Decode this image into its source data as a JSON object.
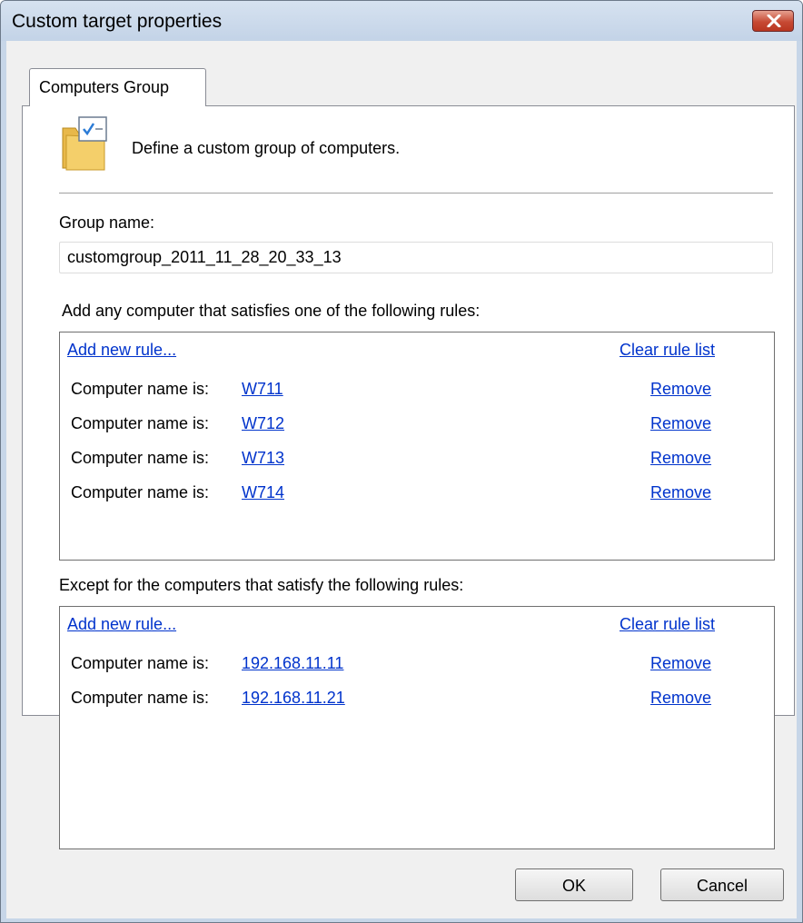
{
  "window": {
    "title": "Custom target properties"
  },
  "tabs": [
    {
      "label": "Computers Group"
    }
  ],
  "header": {
    "text": "Define a custom group of computers."
  },
  "group": {
    "label": "Group name:",
    "value": "customgroup_2011_11_28_20_33_13"
  },
  "include": {
    "label": "Add any computer that satisfies one of the following rules:",
    "add_rule": "Add new rule...",
    "clear": "Clear rule list",
    "rules": [
      {
        "prefix": "Computer name is:",
        "value": "W711",
        "remove": "Remove"
      },
      {
        "prefix": "Computer name is:",
        "value": "W712",
        "remove": "Remove"
      },
      {
        "prefix": "Computer name is:",
        "value": "W713",
        "remove": "Remove"
      },
      {
        "prefix": "Computer name is:",
        "value": "W714",
        "remove": "Remove"
      }
    ]
  },
  "exclude": {
    "label": "Except for the computers that satisfy the following rules:",
    "add_rule": "Add new rule...",
    "clear": "Clear rule list",
    "rules": [
      {
        "prefix": "Computer name is:",
        "value": "192.168.11.11",
        "remove": "Remove"
      },
      {
        "prefix": "Computer name is:",
        "value": "192.168.11.21",
        "remove": "Remove"
      }
    ]
  },
  "buttons": {
    "ok": "OK",
    "cancel": "Cancel"
  },
  "icons": {
    "close": "close-icon",
    "header": "folder-checklist-icon"
  },
  "colors": {
    "link": "#0033cc",
    "close_button": "#c74a34",
    "titlebar": "#c7d6e8"
  }
}
